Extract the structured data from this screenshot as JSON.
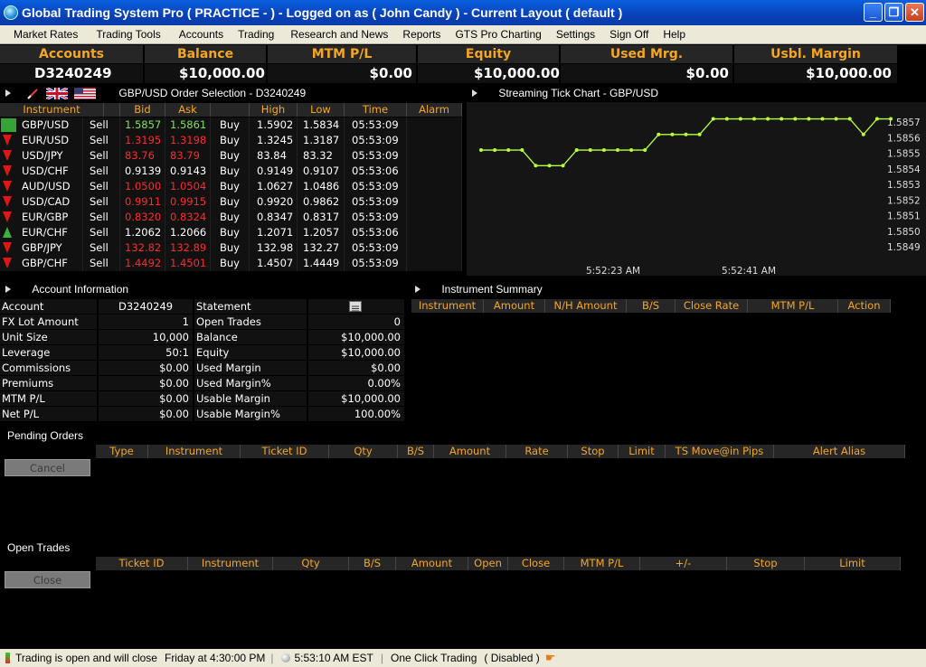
{
  "window": {
    "title": "Global Trading System Pro ( PRACTICE -  ) - Logged on as ( John Candy ) - Current Layout ( default )",
    "minimize": "_",
    "maximize": "❐",
    "close": "✕"
  },
  "menu": [
    "Market Rates",
    "Trading Tools",
    "Accounts",
    "Trading",
    "Research and News",
    "Reports",
    "GTS Pro Charting",
    "Settings",
    "Sign Off",
    "Help"
  ],
  "summary": {
    "headers": [
      "Accounts",
      "Balance",
      "MTM P/L",
      "Equity",
      "Used Mrg.",
      "Usbl. Margin"
    ],
    "values": [
      "D3240249",
      "$10,000.00",
      "$0.00",
      "$10,000.00",
      "$0.00",
      "$10,000.00"
    ]
  },
  "order_selection": {
    "title": "GBP/USD Order Selection - D3240249",
    "columns": [
      "Instrument",
      "",
      "Bid",
      "Ask",
      "",
      "High",
      "Low",
      "Time",
      "Alarm"
    ],
    "rows": [
      {
        "instrument": "GBP/USD",
        "sell": "Sell",
        "bid": "1.5857",
        "ask": "1.5861",
        "buy": "Buy",
        "high": "1.5902",
        "low": "1.5834",
        "time": "05:53:09",
        "dir": "up-box",
        "color": "green"
      },
      {
        "instrument": "EUR/USD",
        "sell": "Sell",
        "bid": "1.3195",
        "ask": "1.3198",
        "buy": "Buy",
        "high": "1.3245",
        "low": "1.3187",
        "time": "05:53:09",
        "dir": "down",
        "color": "red"
      },
      {
        "instrument": "USD/JPY",
        "sell": "Sell",
        "bid": "83.76",
        "ask": "83.79",
        "buy": "Buy",
        "high": "83.84",
        "low": "83.32",
        "time": "05:53:09",
        "dir": "down",
        "color": "red"
      },
      {
        "instrument": "USD/CHF",
        "sell": "Sell",
        "bid": "0.9139",
        "ask": "0.9143",
        "buy": "Buy",
        "high": "0.9149",
        "low": "0.9107",
        "time": "05:53:06",
        "dir": "down",
        "color": "white"
      },
      {
        "instrument": "AUD/USD",
        "sell": "Sell",
        "bid": "1.0500",
        "ask": "1.0504",
        "buy": "Buy",
        "high": "1.0627",
        "low": "1.0486",
        "time": "05:53:09",
        "dir": "down",
        "color": "red"
      },
      {
        "instrument": "USD/CAD",
        "sell": "Sell",
        "bid": "0.9911",
        "ask": "0.9915",
        "buy": "Buy",
        "high": "0.9920",
        "low": "0.9862",
        "time": "05:53:09",
        "dir": "down",
        "color": "red"
      },
      {
        "instrument": "EUR/GBP",
        "sell": "Sell",
        "bid": "0.8320",
        "ask": "0.8324",
        "buy": "Buy",
        "high": "0.8347",
        "low": "0.8317",
        "time": "05:53:09",
        "dir": "down",
        "color": "red"
      },
      {
        "instrument": "EUR/CHF",
        "sell": "Sell",
        "bid": "1.2062",
        "ask": "1.2066",
        "buy": "Buy",
        "high": "1.2071",
        "low": "1.2057",
        "time": "05:53:06",
        "dir": "up",
        "color": "white"
      },
      {
        "instrument": "GBP/JPY",
        "sell": "Sell",
        "bid": "132.82",
        "ask": "132.89",
        "buy": "Buy",
        "high": "132.98",
        "low": "132.27",
        "time": "05:53:09",
        "dir": "down",
        "color": "red"
      },
      {
        "instrument": "GBP/CHF",
        "sell": "Sell",
        "bid": "1.4492",
        "ask": "1.4501",
        "buy": "Buy",
        "high": "1.4507",
        "low": "1.4449",
        "time": "05:53:09",
        "dir": "down",
        "color": "red"
      }
    ]
  },
  "tick_chart": {
    "title": "Streaming Tick Chart - GBP/USD"
  },
  "chart_data": {
    "type": "line",
    "title": "",
    "y_ticks": [
      "1.5857",
      "1.5856",
      "1.5855",
      "1.5854",
      "1.5853",
      "1.5852",
      "1.5851",
      "1.5850",
      "1.5849"
    ],
    "x_ticks": [
      "5:52:23 AM",
      "5:52:41 AM"
    ],
    "ylim": [
      1.5849,
      1.5857
    ],
    "series": [
      {
        "values": [
          1.58552,
          1.58552,
          1.58552,
          1.58552,
          1.58542,
          1.58542,
          1.58542,
          1.58552,
          1.58552,
          1.58552,
          1.58552,
          1.58552,
          1.58552,
          1.58562,
          1.58562,
          1.58562,
          1.58562,
          1.58572,
          1.58572,
          1.58572,
          1.58572,
          1.58572,
          1.58572,
          1.58572,
          1.58572,
          1.58572,
          1.58572,
          1.58572,
          1.58562,
          1.58572,
          1.58572
        ]
      }
    ],
    "color": "#b7ff3a"
  },
  "account_info": {
    "title": "Account Information",
    "left": [
      {
        "label": "Account",
        "value": "D3240249"
      },
      {
        "label": "FX Lot Amount",
        "value": "1"
      },
      {
        "label": "Unit Size",
        "value": "10,000"
      },
      {
        "label": "Leverage",
        "value": "50:1"
      },
      {
        "label": "Commissions",
        "value": "$0.00"
      },
      {
        "label": "Premiums",
        "value": "$0.00"
      },
      {
        "label": "MTM P/L",
        "value": "$0.00"
      },
      {
        "label": "Net P/L",
        "value": "$0.00"
      }
    ],
    "right": [
      {
        "label": "Statement",
        "value": ""
      },
      {
        "label": "Open Trades",
        "value": "0"
      },
      {
        "label": "Balance",
        "value": "$10,000.00"
      },
      {
        "label": "Equity",
        "value": "$10,000.00"
      },
      {
        "label": "Used Margin",
        "value": "$0.00"
      },
      {
        "label": "Used Margin%",
        "value": "0.00%"
      },
      {
        "label": "Usable Margin",
        "value": "$10,000.00"
      },
      {
        "label": "Usable Margin%",
        "value": "100.00%"
      }
    ]
  },
  "instrument_summary": {
    "title": "Instrument Summary",
    "columns": [
      "Instrument",
      "Amount",
      "N/H Amount",
      "B/S",
      "Close Rate",
      "MTM P/L",
      "Action"
    ]
  },
  "pending_orders": {
    "title": "Pending Orders",
    "columns": [
      "Type",
      "Instrument",
      "Ticket ID",
      "Qty",
      "B/S",
      "Amount",
      "Rate",
      "Stop",
      "Limit",
      "TS Move@in Pips",
      "Alert Alias"
    ],
    "button": "Cancel"
  },
  "open_trades": {
    "title": "Open Trades",
    "columns": [
      "Ticket ID",
      "Instrument",
      "Qty",
      "B/S",
      "Amount",
      "Open",
      "Close",
      "MTM P/L",
      "+/-",
      "Stop",
      "Limit"
    ],
    "button": "Close"
  },
  "status": {
    "trading": "Trading is open and will close",
    "close_time": "Friday at 4:30:00 PM",
    "clock": "5:53:10 AM EST",
    "one_click": "One Click Trading",
    "one_click_state": "( Disabled )"
  }
}
